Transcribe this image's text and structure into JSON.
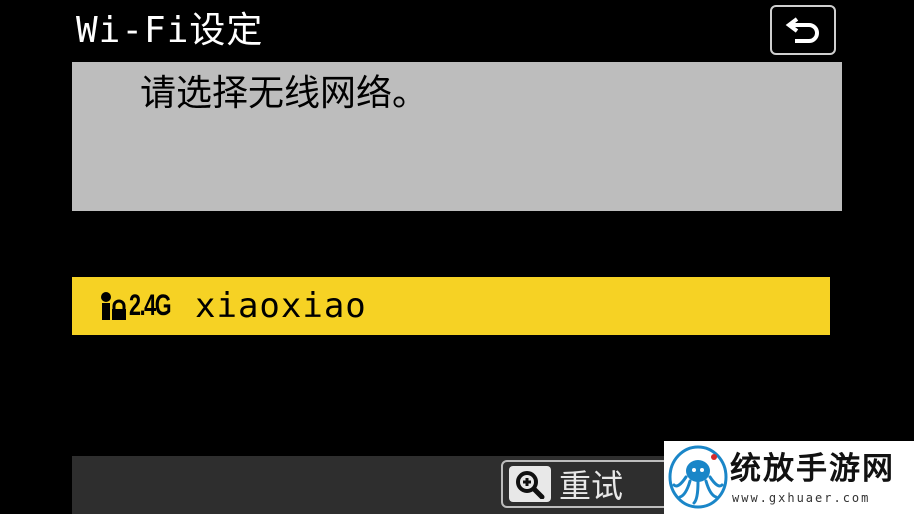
{
  "header": {
    "title": "Wi-Fi设定",
    "back_icon": "return-arrow-icon"
  },
  "message": {
    "text": "请选择无线网络。"
  },
  "networks": [
    {
      "security_icon": "lock-user-icon",
      "band": "2.4G",
      "ssid": "xiaoxiao",
      "selected": true,
      "highlight_color": "#f6d224"
    }
  ],
  "bottom_bar": {
    "retry_icon": "zoom-in-icon",
    "retry_label": "重试"
  },
  "watermark": {
    "title": "统放手游网",
    "url": "www.gxhuaer.com"
  },
  "colors": {
    "background": "#000000",
    "panel": "#bdbdbd",
    "selection": "#f6d224",
    "bottom_bar": "#2e2e2e"
  }
}
